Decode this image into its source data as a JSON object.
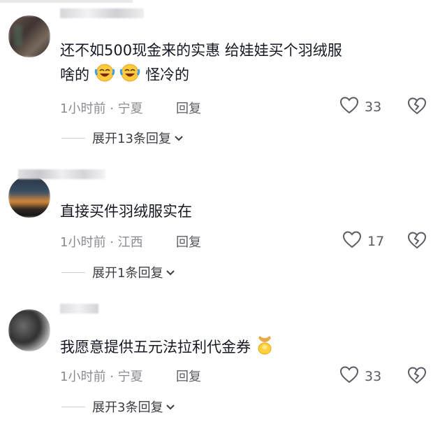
{
  "comments": [
    {
      "text_line1": "还不如500现金来的实惠   给娃娃买个羽绒服",
      "text_line2": "啥的",
      "text_line2_tail": "怪冷的",
      "time": "1小时前",
      "location": "宁夏",
      "reply_label": "回复",
      "likes": "33",
      "expand_label": "展开13条回复"
    },
    {
      "text_line1": "直接买件羽绒服实在",
      "time": "1小时前",
      "location": "江西",
      "reply_label": "回复",
      "likes": "17",
      "expand_label": "展开1条回复"
    },
    {
      "text_line1": "我愿意提供五元法拉利代金券",
      "time": "1小时前",
      "location": "宁夏",
      "reply_label": "回复",
      "likes": "33",
      "expand_label": "展开3条回复"
    }
  ],
  "meta_separator": "·",
  "icons": {
    "like": "heart-outline-icon",
    "dislike": "broken-heart-icon",
    "expand": "chevron-down-icon",
    "emoji_crying_laughing": "crying-laughing-emoji",
    "emoji_gold": "gold-ingot-emoji"
  }
}
